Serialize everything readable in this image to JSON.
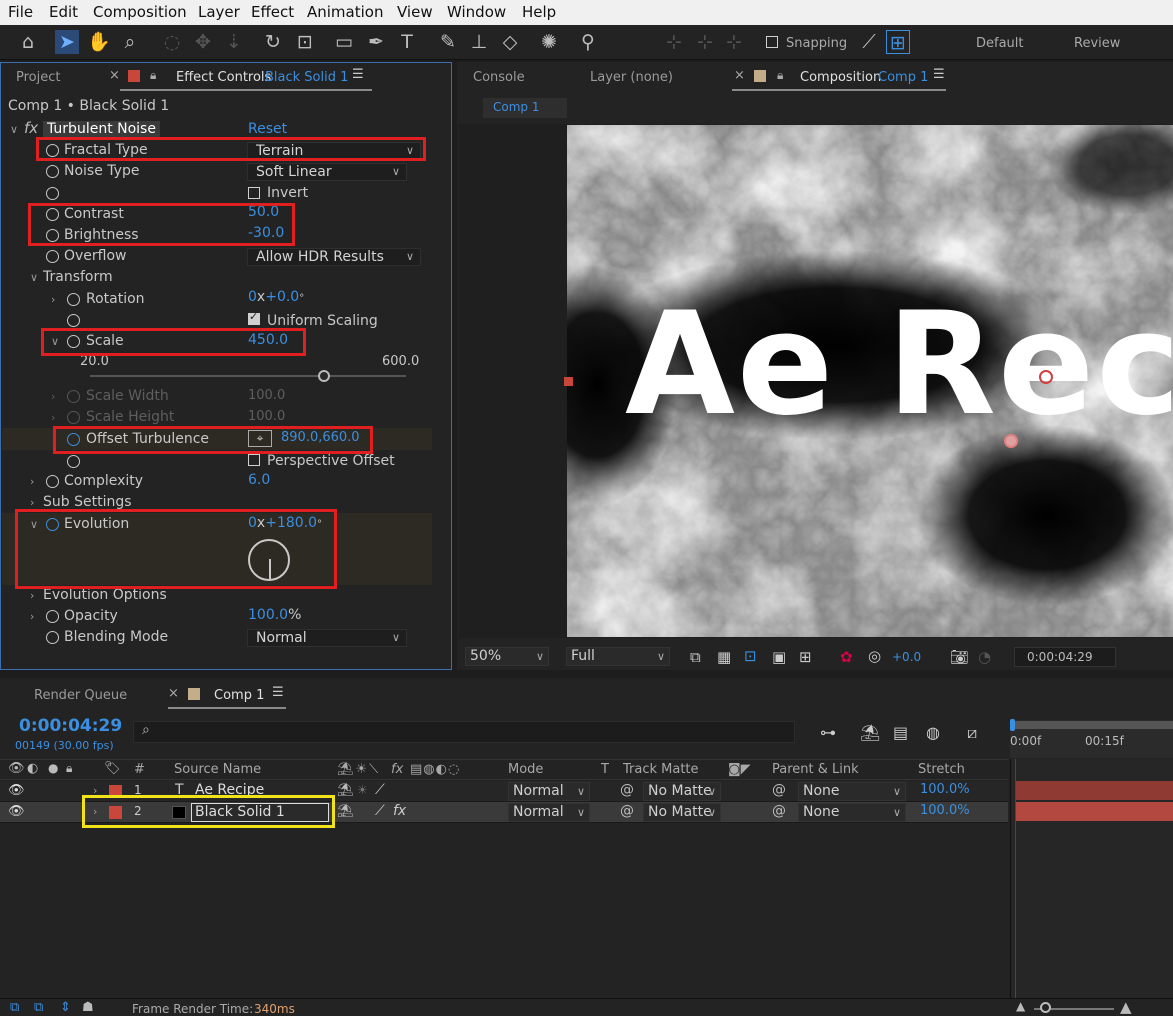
{
  "menu": [
    "File",
    "Edit",
    "Composition",
    "Layer",
    "Effect",
    "Animation",
    "View",
    "Window",
    "Help"
  ],
  "toolbar": {
    "snapping_label": "Snapping",
    "workspaces": [
      "Default",
      "Review"
    ]
  },
  "left_panel": {
    "tab_project": "Project",
    "tab_effect_controls": "Effect Controls",
    "tab_effect_controls_layer": "Black Solid 1",
    "breadcrumb": "Comp 1 • Black Solid 1",
    "fx_badge": "fx",
    "effect_name": "Turbulent Noise",
    "reset_label": "Reset",
    "props": {
      "fractal_type": {
        "label": "Fractal Type",
        "value": "Terrain"
      },
      "noise_type": {
        "label": "Noise Type",
        "value": "Soft Linear"
      },
      "invert": {
        "label": "Invert"
      },
      "contrast": {
        "label": "Contrast",
        "value": "50.0"
      },
      "brightness": {
        "label": "Brightness",
        "value": "-30.0"
      },
      "overflow": {
        "label": "Overflow",
        "value": "Allow HDR Results"
      },
      "transform": {
        "label": "Transform"
      },
      "rotation": {
        "label": "Rotation",
        "value_rev": "0",
        "value_x": "x",
        "value_deg": "+0.0",
        "deg": "°"
      },
      "uniform_scaling": {
        "label": "Uniform Scaling"
      },
      "scale": {
        "label": "Scale",
        "value": "450.0",
        "slider_min": "20.0",
        "slider_max": "600.0",
        "slider_fraction": 0.74
      },
      "scale_width": {
        "label": "Scale Width",
        "value": "100.0"
      },
      "scale_height": {
        "label": "Scale Height",
        "value": "100.0"
      },
      "offset_turbulence": {
        "label": "Offset Turbulence",
        "value": "890.0,660.0"
      },
      "perspective_offset": {
        "label": "Perspective Offset"
      },
      "complexity": {
        "label": "Complexity",
        "value": "6.0"
      },
      "sub_settings": {
        "label": "Sub Settings"
      },
      "evolution": {
        "label": "Evolution",
        "value_rev": "0",
        "value_x": "x",
        "value_deg": "+180.0",
        "deg": "°"
      },
      "evolution_options": {
        "label": "Evolution Options"
      },
      "opacity": {
        "label": "Opacity",
        "value": "100.0",
        "unit": "%"
      },
      "blending_mode": {
        "label": "Blending Mode",
        "value": "Normal"
      }
    }
  },
  "comp_panel": {
    "tab_console": "Console",
    "tab_layer": "Layer (none)",
    "tab_composition": "Composition",
    "tab_composition_name": "Comp 1",
    "sub_tab": "Comp 1",
    "canvas_text": "Ae Rec",
    "zoom": "50%",
    "resolution": "Full",
    "exposure": "+0.0",
    "timecode": "0:00:04:29"
  },
  "timeline": {
    "tab_render_queue": "Render Queue",
    "tab_comp": "Comp 1",
    "timecode": "0:00:04:29",
    "frame_info": "00149 (30.00 fps)",
    "search_icon": "⌕",
    "ruler": [
      "0:00f",
      "00:15f"
    ],
    "columns": {
      "num": "#",
      "source_name": "Source Name",
      "fx": "fx",
      "mode": "Mode",
      "t": "T",
      "track_matte": "Track Matte",
      "parent_link": "Parent & Link",
      "stretch": "Stretch"
    },
    "layers": [
      {
        "num": "1",
        "type_glyph": "T",
        "name": "Ae Recipe",
        "mode": "Normal",
        "matte": "No Matte",
        "parent": "None",
        "stretch": "100.0%"
      },
      {
        "num": "2",
        "type_glyph": "",
        "name": "Black Solid 1",
        "mode": "Normal",
        "matte": "No Matte",
        "parent": "None",
        "stretch": "100.0%"
      }
    ],
    "status_label": "Frame Render Time:",
    "status_value": "340ms"
  },
  "colors": {
    "accent_blue": "#3b8fe0",
    "annotation_red": "#e02020",
    "annotation_yellow": "#f2e21a",
    "label_red": "#c9473a"
  }
}
